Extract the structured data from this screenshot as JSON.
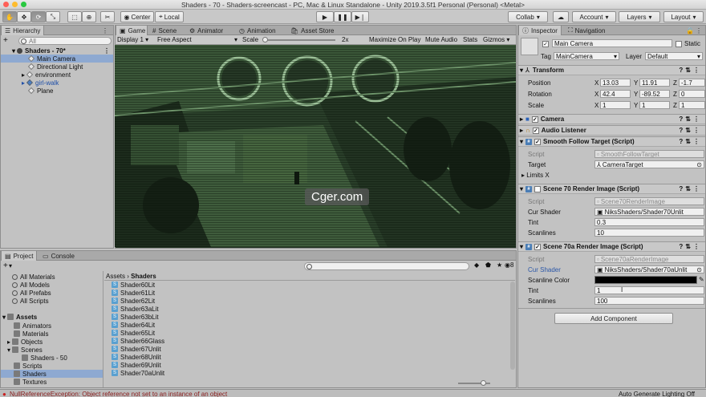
{
  "window": {
    "title": "Shaders - 70 - Shaders-screencast - PC, Mac & Linux Standalone - Unity 2019.3.5f1 Personal (Personal) <Metal>"
  },
  "toolbar": {
    "pivot_label": "Center",
    "space_label": "Local",
    "collab_label": "Collab",
    "account_label": "Account",
    "layers_label": "Layers",
    "layout_label": "Layout"
  },
  "hierarchy": {
    "tab_label": "Hierarchy",
    "add_label": "+",
    "search_placeholder": "All",
    "scene_name": "Shaders - 70*",
    "items": [
      {
        "label": "Main Camera"
      },
      {
        "label": "Directional Light"
      },
      {
        "label": "environment"
      },
      {
        "label": "girl-walk"
      },
      {
        "label": "Plane"
      }
    ]
  },
  "scene_tabs": {
    "game": "Game",
    "scene": "Scene",
    "animator": "Animator",
    "animation": "Animation",
    "asset_store": "Asset Store"
  },
  "game_toolbar": {
    "display": "Display 1",
    "aspect": "Free Aspect",
    "scale_label": "Scale",
    "scale_value": "2x",
    "maximize": "Maximize On Play",
    "mute": "Mute Audio",
    "stats": "Stats",
    "gizmos": "Gizmos"
  },
  "watermark": "Cger.com",
  "project": {
    "tab_project": "Project",
    "tab_console": "Console",
    "add_label": "+",
    "hidden_count": "8",
    "breadcrumb_root": "Assets",
    "breadcrumb_current": "Shaders",
    "favorites": [
      "All Materials",
      "All Models",
      "All Prefabs",
      "All Scripts"
    ],
    "assets_root": "Assets",
    "folders": [
      "Animators",
      "Materials",
      "Objects",
      "Scenes",
      "Shaders - 50",
      "Scripts",
      "Shaders",
      "Textures"
    ],
    "files": [
      "Shader60Lit",
      "Shader61Lit",
      "Shader62Lit",
      "Shader63aLit",
      "Shader63bLit",
      "Shader64Lit",
      "Shader65Lit",
      "Shader66Glass",
      "Shader67Unlit",
      "Shader68Unlit",
      "Shader69Unlit",
      "Shader70aUnlit"
    ]
  },
  "inspector": {
    "tab_inspector": "Inspector",
    "tab_navigation": "Navigation",
    "object_name": "Main Camera",
    "static_label": "Static",
    "tag_label": "Tag",
    "tag_value": "MainCamera",
    "layer_label": "Layer",
    "layer_value": "Default",
    "transform": {
      "header": "Transform",
      "position_label": "Position",
      "rotation_label": "Rotation",
      "scale_label": "Scale",
      "position": {
        "x": "13.03",
        "y": "11.91",
        "z": "-1.7"
      },
      "rotation": {
        "x": "42.4",
        "y": "-89.52",
        "z": "0"
      },
      "scale": {
        "x": "1",
        "y": "1",
        "z": "1"
      }
    },
    "camera_header": "Camera",
    "audio_header": "Audio Listener",
    "smooth_follow": {
      "header": "Smooth Follow Target (Script)",
      "script_label": "Script",
      "script_value": "SmoothFollowTarget",
      "target_label": "Target",
      "target_value": "CameraTarget",
      "limits_label": "Limits X"
    },
    "render70": {
      "header": "Scene 70 Render Image (Script)",
      "script_label": "Script",
      "script_value": "Scene70RenderImage",
      "shader_label": "Cur Shader",
      "shader_value": "NiksShaders/Shader70Unlit",
      "tint_label": "Tint",
      "tint_value": "0.3",
      "scanlines_label": "Scanlines",
      "scanlines_value": "10"
    },
    "render70a": {
      "header": "Scene 70a Render Image (Script)",
      "script_label": "Script",
      "script_value": "Scene70aRenderImage",
      "shader_label": "Cur Shader",
      "shader_value": "NiksShaders/Shader70aUnlit",
      "color_label": "Scanline Color",
      "scanline_color": "#000000",
      "tint_label": "Tint",
      "tint_value": "1",
      "scanlines_label": "Scanlines",
      "scanlines_value": "100"
    },
    "add_component": "Add Component"
  },
  "status": {
    "error": "NullReferenceException: Object reference not set to an instance of an object",
    "right": "Auto Generate Lighting Off"
  }
}
